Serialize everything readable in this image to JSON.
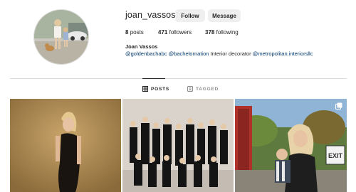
{
  "profile": {
    "username": "joan_vassos",
    "follow_label": "Follow",
    "message_label": "Message",
    "posts_count": "8",
    "posts_label": "posts",
    "followers_count": "471",
    "followers_label": "followers",
    "following_count": "378",
    "following_label": "following",
    "full_name": "Joan Vassos",
    "bio_tag1": "@goldenbachabc",
    "bio_tag2": "@bachelornation",
    "bio_text": "Interior decorator",
    "bio_tag3": "@metropolitan.interiorsllc"
  },
  "tabs": [
    {
      "label": "POSTS",
      "icon": "grid-icon",
      "active": true
    },
    {
      "label": "TAGGED",
      "icon": "tagged-icon",
      "active": false
    }
  ],
  "grid": [
    {
      "description_icon": "photo-woman-black-dress"
    },
    {
      "description_icon": "photo-group-women"
    },
    {
      "description_icon": "photo-woman-child-exit-sign",
      "multi": true
    }
  ],
  "colors": {
    "link": "#00376b",
    "button_bg": "#efefef",
    "divider": "#dbdbdb",
    "muted": "#8e8e8e"
  }
}
